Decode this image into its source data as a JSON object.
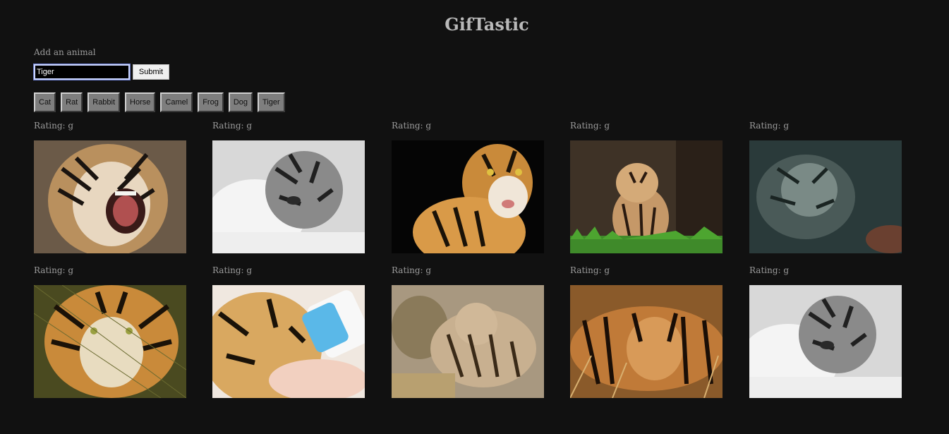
{
  "header": {
    "title": "GifTastic"
  },
  "form": {
    "label": "Add an animal",
    "input_value": "Tiger",
    "submit_label": "Submit"
  },
  "animal_buttons": [
    "Cat",
    "Rat",
    "Rabbit",
    "Horse",
    "Camel",
    "Frog",
    "Dog",
    "Tiger"
  ],
  "gifs": [
    {
      "rating": "Rating: g",
      "image": "tiger-roaring-gif",
      "watermark": ""
    },
    {
      "rating": "Rating: g",
      "image": "tiger-cub-bw-gif",
      "watermark": ""
    },
    {
      "rating": "Rating: g",
      "image": "tiger-portrait-black-bg-gif",
      "watermark": ""
    },
    {
      "rating": "Rating: g",
      "image": "tiger-cub-cave-gif",
      "watermark": ""
    },
    {
      "rating": "Rating: g",
      "image": "tiger-underwater-gif",
      "watermark": ""
    },
    {
      "rating": "Rating: g",
      "image": "tiger-face-grass-gif",
      "watermark": ""
    },
    {
      "rating": "Rating: g",
      "image": "tiger-cub-bottle-gif",
      "watermark": ""
    },
    {
      "rating": "Rating: g",
      "image": "tiger-and-leopard-gif",
      "watermark": ""
    },
    {
      "rating": "Rating: g",
      "image": "tiger-lying-grass-gif",
      "watermark": ""
    },
    {
      "rating": "Rating: g",
      "image": "tiger-cub-bw-gif-2",
      "watermark": ""
    }
  ],
  "colors": {
    "background": "#111111",
    "text": "#9a9a9a",
    "title": "#b9b9b9",
    "button": "#7e7e7e"
  }
}
